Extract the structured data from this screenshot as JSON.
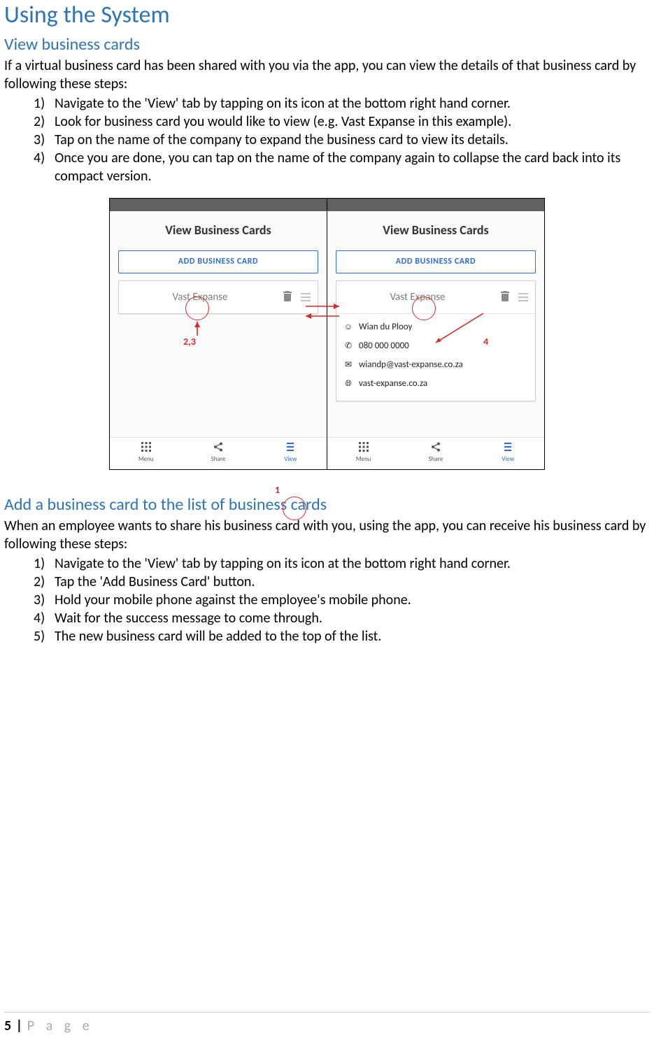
{
  "section1": {
    "title": "Using the System",
    "subtitle": "View business cards",
    "intro": "If a virtual business card has been shared with you via the app, you can view the details of that business card by following these steps:",
    "steps": [
      "Navigate to the 'View' tab by tapping on its icon at the bottom right hand corner.",
      "Look for business card you would like to view (e.g. Vast Expanse in this example).",
      "Tap on the name of the company to expand the business card to view its details.",
      "Once you are done, you can tap on the name of the company again to collapse the card back into its compact version."
    ]
  },
  "figure": {
    "phoneLeft": {
      "title": "View Business Cards",
      "addButton": "ADD BUSINESS CARD",
      "company": "Vast Expanse",
      "tabs": {
        "menu": "Menu",
        "share": "Share",
        "view": "View"
      }
    },
    "phoneRight": {
      "title": "View Business Cards",
      "addButton": "ADD BUSINESS CARD",
      "company": "Vast Expanse",
      "details": {
        "person": "Wian du Plooy",
        "phone": "080 000 0000",
        "email": "wiandp@vast-expanse.co.za",
        "website": "vast-expanse.co.za"
      },
      "tabs": {
        "menu": "Menu",
        "share": "Share",
        "view": "View"
      }
    },
    "callouts": {
      "one": "1",
      "twothree": "2,3",
      "four": "4"
    }
  },
  "section2": {
    "subtitle": "Add a business card to the list of business cards",
    "intro": "When an employee wants to share his business card with you, using the app, you can receive his business card by following these steps:",
    "steps": [
      "Navigate to the 'View' tab by tapping on its icon at the bottom right hand corner.",
      "Tap the 'Add Business Card' button.",
      "Hold your mobile phone against the employee's mobile phone.",
      "Wait for the success message to come through.",
      "The new business card will be added to the top of the list."
    ]
  },
  "footer": {
    "pageNum": "5",
    "divider": "|",
    "pageWord": "P a g e"
  }
}
